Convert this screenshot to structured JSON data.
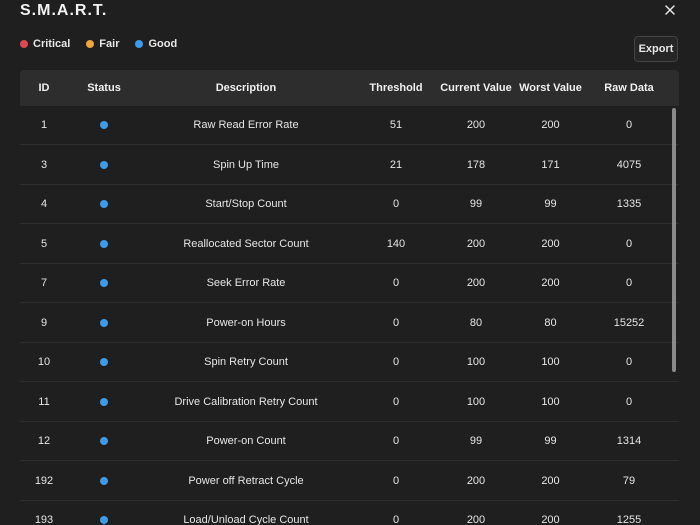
{
  "window": {
    "title": "S.M.A.R.T.",
    "close_icon": "close-icon"
  },
  "legend": {
    "items": [
      {
        "label": "Critical",
        "color": "#e0484f"
      },
      {
        "label": "Fair",
        "color": "#f0a43c"
      },
      {
        "label": "Good",
        "color": "#3e9be9"
      }
    ]
  },
  "toolbar": {
    "export_label": "Export"
  },
  "table": {
    "columns": [
      "ID",
      "Status",
      "Description",
      "Threshold",
      "Current Value",
      "Worst Value",
      "Raw Data"
    ],
    "rows": [
      {
        "id": "1",
        "status": "Good",
        "description": "Raw Read Error Rate",
        "threshold": "51",
        "current": "200",
        "worst": "200",
        "raw": "0"
      },
      {
        "id": "3",
        "status": "Good",
        "description": "Spin Up Time",
        "threshold": "21",
        "current": "178",
        "worst": "171",
        "raw": "4075"
      },
      {
        "id": "4",
        "status": "Good",
        "description": "Start/Stop Count",
        "threshold": "0",
        "current": "99",
        "worst": "99",
        "raw": "1335"
      },
      {
        "id": "5",
        "status": "Good",
        "description": "Reallocated Sector Count",
        "threshold": "140",
        "current": "200",
        "worst": "200",
        "raw": "0"
      },
      {
        "id": "7",
        "status": "Good",
        "description": "Seek Error Rate",
        "threshold": "0",
        "current": "200",
        "worst": "200",
        "raw": "0"
      },
      {
        "id": "9",
        "status": "Good",
        "description": "Power-on Hours",
        "threshold": "0",
        "current": "80",
        "worst": "80",
        "raw": "15252"
      },
      {
        "id": "10",
        "status": "Good",
        "description": "Spin Retry Count",
        "threshold": "0",
        "current": "100",
        "worst": "100",
        "raw": "0"
      },
      {
        "id": "11",
        "status": "Good",
        "description": "Drive Calibration Retry Count",
        "threshold": "0",
        "current": "100",
        "worst": "100",
        "raw": "0"
      },
      {
        "id": "12",
        "status": "Good",
        "description": "Power-on Count",
        "threshold": "0",
        "current": "99",
        "worst": "99",
        "raw": "1314"
      },
      {
        "id": "192",
        "status": "Good",
        "description": "Power off Retract Cycle",
        "threshold": "0",
        "current": "200",
        "worst": "200",
        "raw": "79"
      },
      {
        "id": "193",
        "status": "Good",
        "description": "Load/Unload Cycle Count",
        "threshold": "0",
        "current": "200",
        "worst": "200",
        "raw": "1255"
      }
    ]
  },
  "status_colors": {
    "Critical": "#e0484f",
    "Fair": "#f0a43c",
    "Good": "#3e9be9"
  }
}
